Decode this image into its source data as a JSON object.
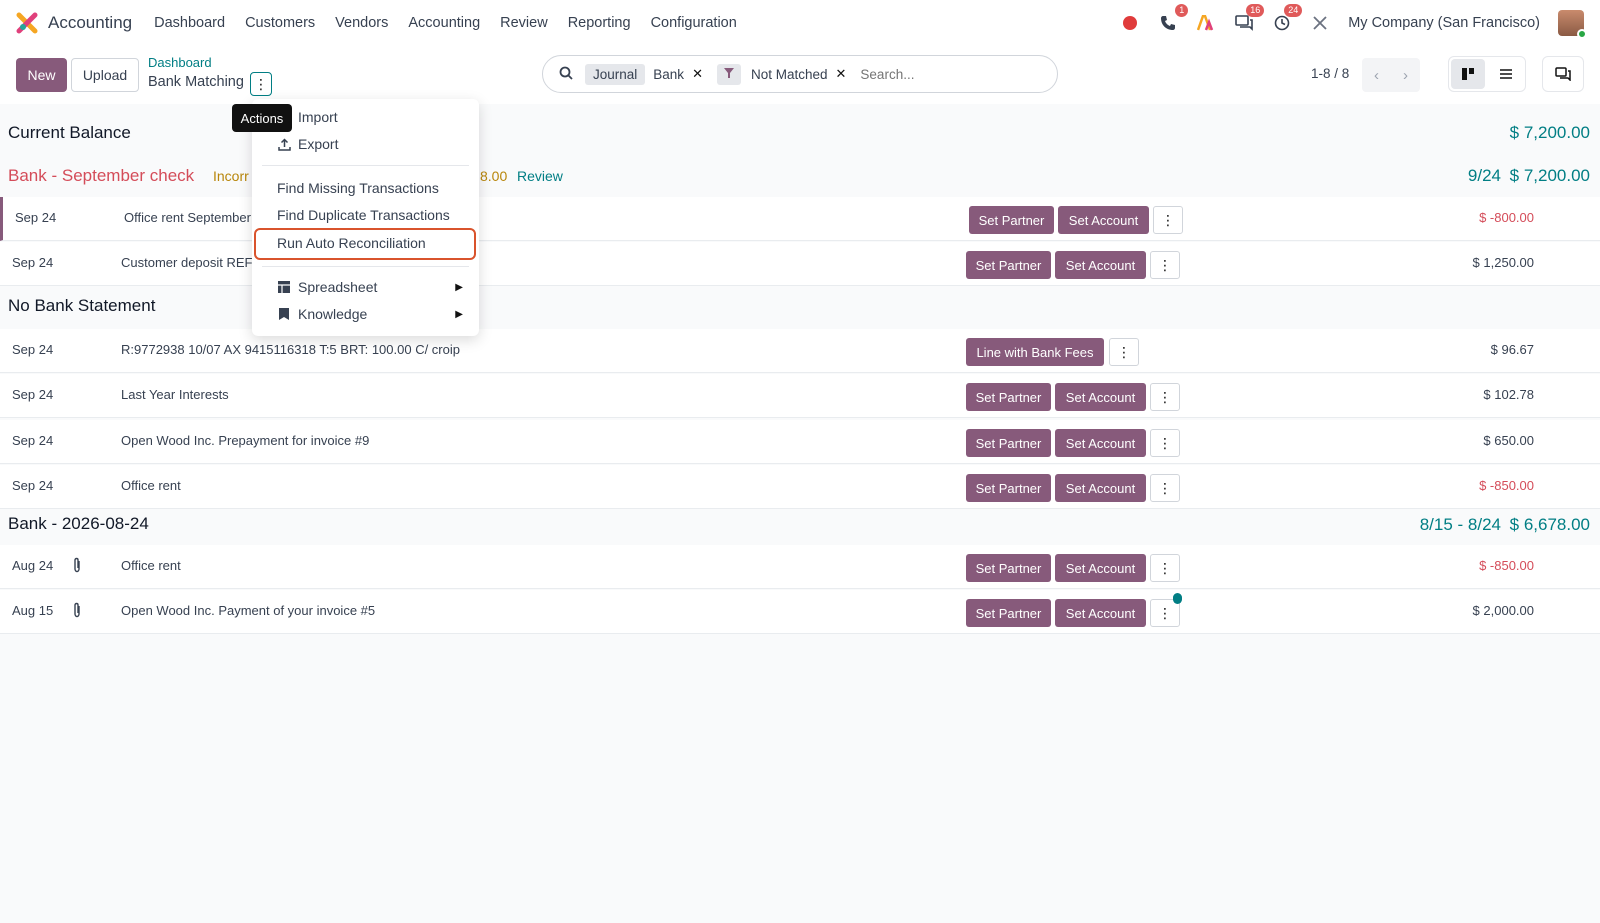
{
  "app": {
    "name": "Accounting"
  },
  "nav": {
    "items": [
      "Dashboard",
      "Customers",
      "Vendors",
      "Accounting",
      "Review",
      "Reporting",
      "Configuration"
    ]
  },
  "systray": {
    "phone_badge": "1",
    "messages_badge": "16",
    "activities_badge": "24",
    "company": "My Company (San Francisco)"
  },
  "control": {
    "new_label": "New",
    "upload_label": "Upload",
    "breadcrumb": "Dashboard",
    "title": "Bank Matching",
    "actions_tooltip": "Actions",
    "pager": "1-8 / 8"
  },
  "search": {
    "facet_journal_label": "Journal",
    "facet_journal_value": "Bank",
    "facet_filter_value": "Not Matched",
    "placeholder": "Search..."
  },
  "actions_menu": {
    "import": "Import",
    "export": "Export",
    "find_missing": "Find Missing Transactions",
    "find_duplicate": "Find Duplicate Transactions",
    "run_auto": "Run Auto Reconciliation",
    "spreadsheet": "Spreadsheet",
    "knowledge": "Knowledge"
  },
  "current_balance": {
    "label": "Current Balance",
    "amount": "$ 7,200.00"
  },
  "groups": [
    {
      "title": "Bank - September check",
      "warning": "Incorr",
      "warning_tail": "8.00",
      "review": "Review",
      "range": "9/24",
      "total": "$ 7,200.00",
      "rows": [
        {
          "date": "Sep 24",
          "label": "Office rent September",
          "amount": "$ -800.00",
          "btn1": "Set Partner",
          "btn2": "Set Account"
        },
        {
          "date": "Sep 24",
          "label": "Customer deposit REF",
          "amount": "$ 1,250.00",
          "btn1": "Set Partner",
          "btn2": "Set Account"
        }
      ]
    },
    {
      "title": "No Bank Statement",
      "rows": [
        {
          "date": "Sep 24",
          "label": "R:9772938 10/07 AX 9415116318 T:5 BRT: 100.00 C/ croip",
          "amount": "$ 96.67",
          "btn1": "Line with Bank Fees"
        },
        {
          "date": "Sep 24",
          "label": "Last Year Interests",
          "amount": "$ 102.78",
          "btn1": "Set Partner",
          "btn2": "Set Account"
        },
        {
          "date": "Sep 24",
          "label": "Open Wood Inc. Prepayment for invoice #9",
          "amount": "$ 650.00",
          "btn1": "Set Partner",
          "btn2": "Set Account"
        },
        {
          "date": "Sep 24",
          "label": "Office rent",
          "amount": "$ -850.00",
          "btn1": "Set Partner",
          "btn2": "Set Account"
        }
      ]
    },
    {
      "title": "Bank - 2026-08-24",
      "range": "8/15 - 8/24",
      "total": "$ 6,678.00",
      "rows": [
        {
          "date": "Aug 24",
          "label": "Office rent",
          "amount": "$ -850.00",
          "btn1": "Set Partner",
          "btn2": "Set Account"
        },
        {
          "date": "Aug 15",
          "label": "Open Wood Inc. Payment of your invoice #5",
          "amount": "$ 2,000.00",
          "btn1": "Set Partner",
          "btn2": "Set Account"
        }
      ]
    }
  ],
  "colors": {
    "brand": "#875a7b",
    "teal": "#017e84",
    "negative": "#d44c59",
    "highlight": "#d9532c"
  }
}
